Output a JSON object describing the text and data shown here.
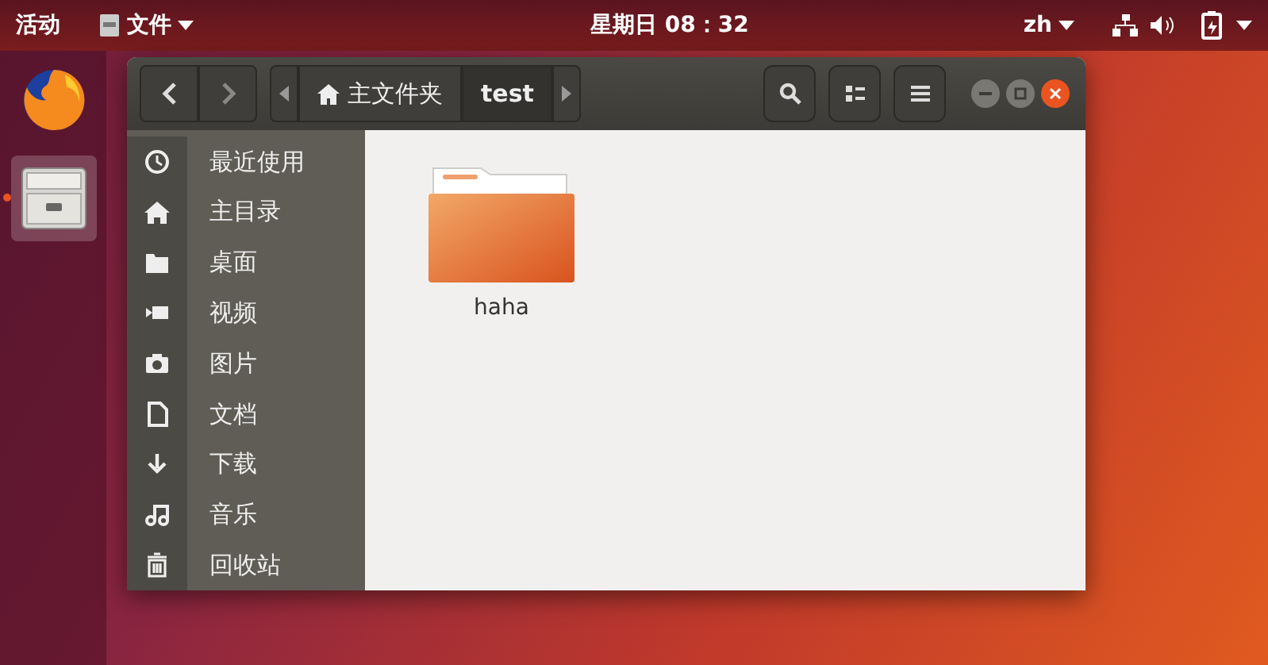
{
  "top_bar": {
    "activities": "活动",
    "app_menu": "文件",
    "clock": "星期日 08：32",
    "input_method": "zh"
  },
  "dock": [
    {
      "kind": "browser",
      "running": false
    },
    {
      "kind": "files",
      "running": true
    }
  ],
  "window": {
    "breadcrumbs": [
      {
        "label": "主文件夹",
        "kind": "home",
        "selected": false
      },
      {
        "label": "test",
        "kind": "plain",
        "selected": true
      }
    ],
    "sidebar": [
      {
        "label": "最近使用",
        "kind": "recent"
      },
      {
        "label": "主目录",
        "kind": "home"
      },
      {
        "label": "桌面",
        "kind": "desktop"
      },
      {
        "label": "视频",
        "kind": "video"
      },
      {
        "label": "图片",
        "kind": "photo"
      },
      {
        "label": "文档",
        "kind": "document"
      },
      {
        "label": "下载",
        "kind": "download"
      },
      {
        "label": "音乐",
        "kind": "music"
      },
      {
        "label": "回收站",
        "kind": "trash"
      }
    ],
    "files": [
      {
        "name": "haha",
        "kind": "folder"
      }
    ]
  }
}
